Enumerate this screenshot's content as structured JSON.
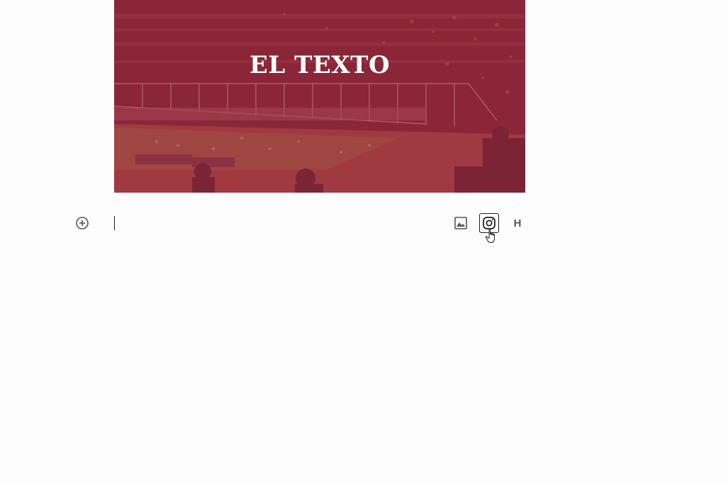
{
  "cover": {
    "title": "EL TEXTO",
    "overlay_color": "#962c3c"
  },
  "inserter": {
    "add_block_icon": "plus-circle-icon"
  },
  "inline_tools": {
    "image_icon": "image-icon",
    "instagram_icon": "instagram-icon",
    "heading_label": "H"
  },
  "colors": {
    "icon": "#50575e",
    "focus_border": "#1e1e1e"
  }
}
